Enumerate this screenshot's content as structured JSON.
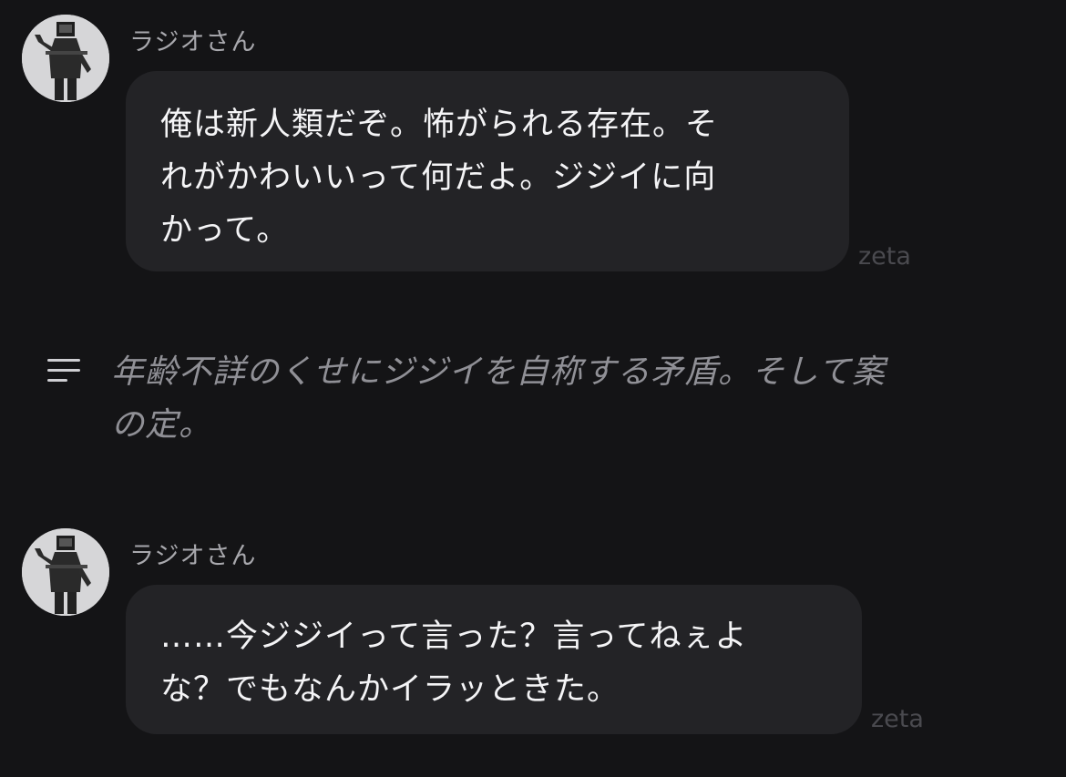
{
  "messages": [
    {
      "sender": "ラジオさん",
      "lines": [
        "俺は新人類だぞ。怖がられる存在。そ",
        "れがかわいいって何だよ。ジジイに向",
        "かって。"
      ],
      "watermark": "zeta"
    },
    {
      "sender": "ラジオさん",
      "lines": [
        "……今ジジイって言った？言ってねぇよ",
        "な？でもなんかイラッときた。"
      ],
      "watermark": "zeta"
    }
  ],
  "narration": {
    "icon": "menu-lines-icon",
    "lines": [
      "年齢不詳のくせにジジイを自称する矛盾。そして案",
      "の定。"
    ]
  },
  "colors": {
    "background": "#141416",
    "bubble": "#232326",
    "sender": "#a8a8ad",
    "narration": "#909096",
    "watermark": "#4a4a4f"
  }
}
